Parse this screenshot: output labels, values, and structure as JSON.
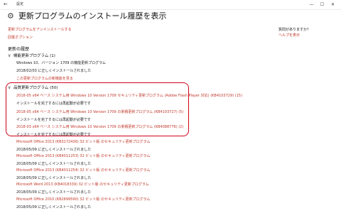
{
  "window": {
    "title": "設定",
    "back_glyph": "←",
    "minimize_glyph": "—",
    "maximize_glyph": "☐",
    "close_glyph": "✕"
  },
  "header": {
    "icon": "gear-icon",
    "icon_glyph": "⚙",
    "title": "更新プログラムのインストール履歴を表示"
  },
  "links": {
    "uninstall": "更新プログラムをアンインストールする",
    "recovery": "回復オプション"
  },
  "side": {
    "question": "質問がありますか？",
    "help": "ヘルプを表示"
  },
  "history": {
    "heading": "更新の履歴",
    "feature_section": {
      "label": "機能更新プログラム (1)",
      "chevron": "∨",
      "items": [
        {
          "title": "Windows 10、バージョン 1709 の機能更新プログラム",
          "status": "2018/02/03 に正しくインストールされました",
          "link": "この更新プログラムの新機能を見る"
        }
      ]
    },
    "quality_section": {
      "label": "品質更新プログラム (50)",
      "chevron": "∨",
      "items": [
        {
          "title": "2018-05 x64 ベース システム用 Windows 10 Version 1709 セキュリティ更新プログラム (Adobe Flash Player 対応) (KB4103729) (15)",
          "status": "インストールを完了するには再起動が必要です"
        },
        {
          "title": "2018-05 x64 ベース システム用 Windows 10 Version 1709 の累積更新プログラム (KB4103727) (5)",
          "status": "インストールを完了するには再起動が必要です"
        },
        {
          "title": "2018-03 x64 ベース システム用 Windows 10 Version 1709 の累積更新プログラム (KB4088776) (2)",
          "status": "インストールを完了するには再起動が必要です"
        },
        {
          "title": "Microsoft Office 2013 (KB3172436) 32 ビット版 のセキュリティ更新プログラム",
          "status": "2018/05/09 に正しくインストールされました"
        },
        {
          "title": "Microsoft Office 2013 (KB4011253) 32 ビット版 のセキュリティ更新プログラム",
          "status": "2018/05/09 に正しくインストールされました"
        },
        {
          "title": "Microsoft Office 2013 (KB4011254) 32 ビット版 のセキュリティ更新プログラム",
          "status": "2018/05/09 に正しくインストールされました"
        },
        {
          "title": "Microsoft Word 2013 (KB4018339) 32 ビット版 のセキュリティ更新プログラム",
          "status": "2018/05/09 に正しくインストールされました"
        },
        {
          "title": "Microsoft Office 2010 (KB2899590) 32 ビット版 のセキュリティ更新プログラム",
          "status": "2018/05/09 に正しくインストールされました"
        }
      ]
    }
  },
  "colors": {
    "link": "#c0392b",
    "highlight_border": "#d0021b"
  }
}
